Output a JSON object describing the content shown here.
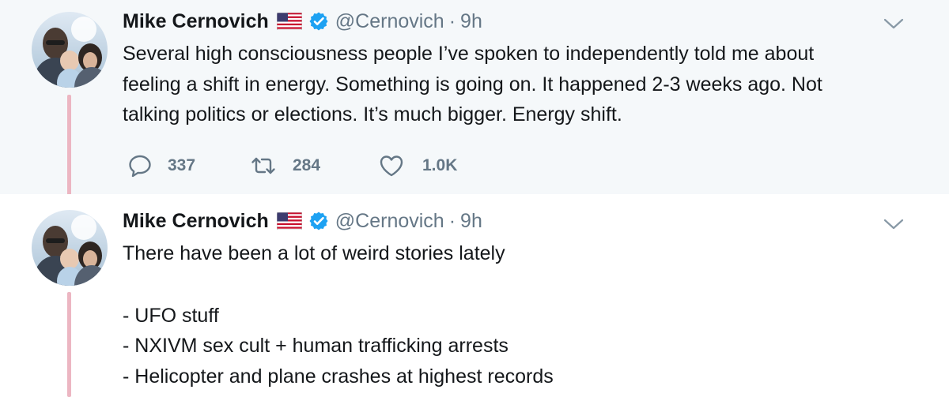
{
  "tweets": [
    {
      "author": {
        "name": "Mike Cernovich",
        "handle": "@Cernovich",
        "separator": "·",
        "time": "9h",
        "flag_icon": "us-flag-icon",
        "verified_icon": "verified-badge-icon"
      },
      "lines": [
        "Several high consciousness people I’ve spoken to independently told me about",
        "feeling a shift in energy. Something is going on. It happened 2-3 weeks ago. Not",
        "talking politics or elections. It’s much bigger. Energy shift."
      ],
      "actions": {
        "replies": "337",
        "retweets": "284",
        "likes": "1.0K"
      }
    },
    {
      "author": {
        "name": "Mike Cernovich",
        "handle": "@Cernovich",
        "separator": "·",
        "time": "9h",
        "flag_icon": "us-flag-icon",
        "verified_icon": "verified-badge-icon"
      },
      "lines": [
        "There have been a lot of weird stories lately",
        "",
        "- UFO stuff",
        "- NXIVM sex cult + human trafficking arrests",
        "- Helicopter and plane crashes at highest records"
      ]
    }
  ],
  "colors": {
    "thread_line": "#ecb6c2",
    "verified": "#1da1f2",
    "secondary_text": "#657786",
    "primary_text": "#14171a",
    "focused_background": "#f5f8fa"
  }
}
